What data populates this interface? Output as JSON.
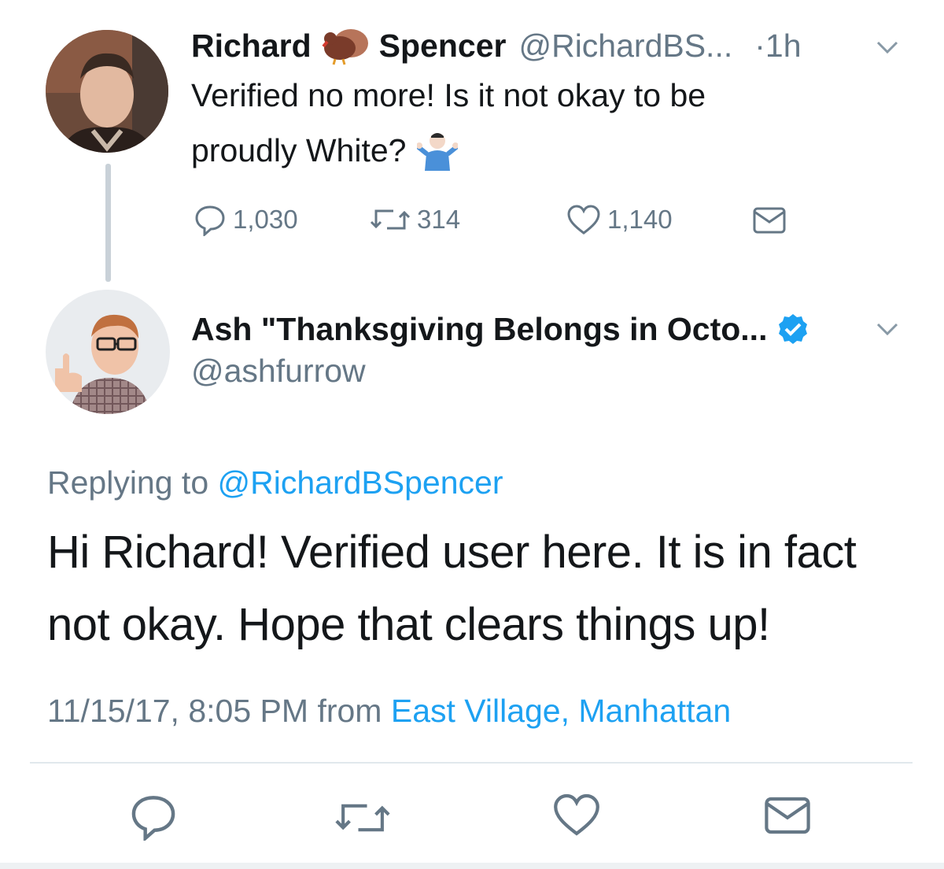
{
  "original_tweet": {
    "name_first": "Richard",
    "name_last": "Spencer",
    "handle": "@RichardBS...",
    "time": "·1h",
    "text_line1": "Verified no more! Is it not okay to be",
    "text_line2": "proudly White?",
    "emoji_turkey": "turkey-icon",
    "emoji_shrug": "person-shrugging-icon",
    "stats": {
      "replies": "1,030",
      "retweets": "314",
      "likes": "1,140"
    }
  },
  "reply_tweet": {
    "name": "Ash \"Thanksgiving Belongs in Octo...",
    "handle": "@ashfurrow",
    "verified": true,
    "replying_prefix": "Replying to",
    "replying_to": "@RichardBSpencer",
    "text_line1": "Hi Richard! Verified user here. It is in fact",
    "text_line2": "not okay. Hope that clears things up!",
    "timestamp": "11/15/17, 8:05 PM",
    "from_prefix": "from",
    "location": "East Village, Manhattan"
  },
  "colors": {
    "accent": "#1da1f2",
    "muted": "#657786",
    "text": "#14171a",
    "divider": "#e1e8ed"
  }
}
